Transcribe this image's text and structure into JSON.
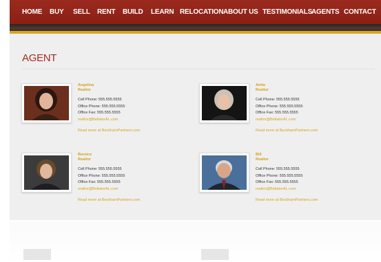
{
  "nav": {
    "items": [
      "HOME",
      "BUY",
      "SELL",
      "RENT",
      "BUILD",
      "LEARN",
      "RELOCATION",
      "ABOUT US",
      "TESTIMONIALS",
      "AGENTS",
      "CONTACT"
    ]
  },
  "page": {
    "title": "AGENT"
  },
  "labels": {
    "cell": "Cell Phone:",
    "office": "Office Phone:",
    "fax": "Office Fax:"
  },
  "agents": [
    {
      "name": "Angelina",
      "role": "Realtor",
      "cell": "555.555.5555",
      "office": "555.555.5555",
      "fax": "555.555.5555",
      "email": "realtor@BellatorAL.com",
      "more": "Read more at BeckhamPartners.com"
    },
    {
      "name": "Anita",
      "role": "Realtor",
      "cell": "555.555.5555",
      "office": "555.555.5555",
      "fax": "555.555.5555",
      "email": "realtor@BellatorAL.com",
      "more": "Read more at BeckhamPartners.com"
    },
    {
      "name": "Bernice",
      "role": "Realtor",
      "cell": "555.555.5555",
      "office": "555.555.5555",
      "fax": "555.555.5555",
      "email": "realtor@BellatorAL.com",
      "more": "Read more at BeckhamPartners.com"
    },
    {
      "name": "Bill",
      "role": "Realtor",
      "cell": "555.555.5555",
      "office": "555.555.5555",
      "fax": "555.555.5555",
      "email": "realtor@BellatorAL.com",
      "more": "Read more at BeckhamPartners.com"
    }
  ],
  "colors": {
    "nav_bg": "#8b1f15",
    "accent_gold": "#d6a21c",
    "title_red": "#a32a1f"
  }
}
